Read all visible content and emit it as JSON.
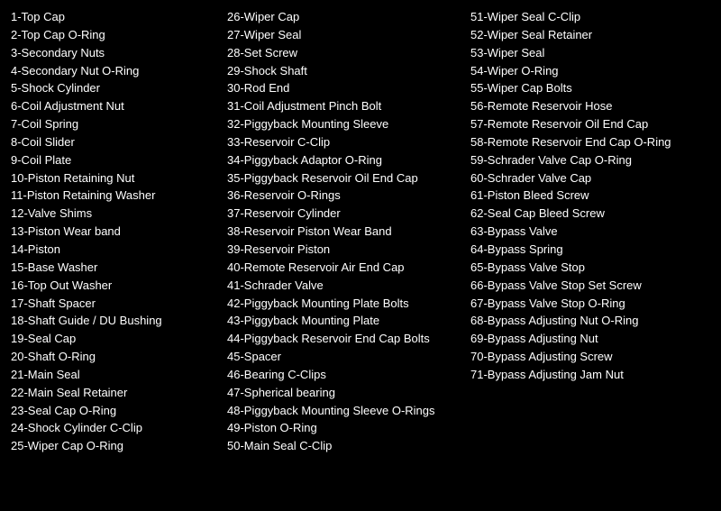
{
  "col1": [
    "1-Top Cap",
    "2-Top Cap O-Ring",
    "3-Secondary Nuts",
    "4-Secondary Nut O-Ring",
    "5-Shock Cylinder",
    "6-Coil Adjustment Nut",
    "7-Coil Spring",
    "8-Coil Slider",
    "9-Coil Plate",
    "10-Piston Retaining Nut",
    "11-Piston Retaining Washer",
    "12-Valve Shims",
    "13-Piston Wear band",
    "14-Piston",
    "15-Base Washer",
    "16-Top Out Washer",
    "17-Shaft Spacer",
    "18-Shaft Guide / DU Bushing",
    "19-Seal Cap",
    "20-Shaft O-Ring",
    "21-Main Seal",
    "22-Main Seal Retainer",
    "23-Seal Cap O-Ring",
    "24-Shock Cylinder C-Clip",
    "25-Wiper Cap O-Ring"
  ],
  "col2": [
    "26-Wiper Cap",
    "27-Wiper Seal",
    "28-Set Screw",
    "29-Shock Shaft",
    "30-Rod End",
    "31-Coil Adjustment Pinch Bolt",
    "32-Piggyback Mounting Sleeve",
    "33-Reservoir C-Clip",
    "34-Piggyback Adaptor O-Ring",
    "35-Piggyback Reservoir Oil End Cap",
    "36-Reservoir O-Rings",
    "37-Reservoir Cylinder",
    "38-Reservoir Piston Wear Band",
    "39-Reservoir Piston",
    "40-Remote Reservoir Air End Cap",
    "41-Schrader Valve",
    "42-Piggyback Mounting Plate Bolts",
    "43-Piggyback Mounting Plate",
    "44-Piggyback Reservoir End Cap Bolts",
    "45-Spacer",
    "46-Bearing C-Clips",
    "47-Spherical bearing",
    "48-Piggyback Mounting Sleeve O-Rings",
    "49-Piston O-Ring",
    "50-Main Seal C-Clip"
  ],
  "col3": [
    "51-Wiper Seal C-Clip",
    "52-Wiper Seal Retainer",
    "53-Wiper Seal",
    "54-Wiper O-Ring",
    "55-Wiper Cap Bolts",
    "56-Remote Reservoir Hose",
    "57-Remote Reservoir Oil End Cap",
    "58-Remote Reservoir End Cap O-Ring",
    "59-Schrader Valve Cap O-Ring",
    "60-Schrader Valve Cap",
    "61-Piston Bleed Screw",
    "62-Seal Cap Bleed Screw",
    "63-Bypass Valve",
    "64-Bypass Spring",
    "65-Bypass Valve Stop",
    "66-Bypass Valve Stop Set Screw",
    "67-Bypass Valve Stop O-Ring",
    "68-Bypass Adjusting Nut O-Ring",
    "69-Bypass Adjusting Nut",
    "70-Bypass Adjusting Screw",
    "71-Bypass Adjusting Jam Nut"
  ]
}
